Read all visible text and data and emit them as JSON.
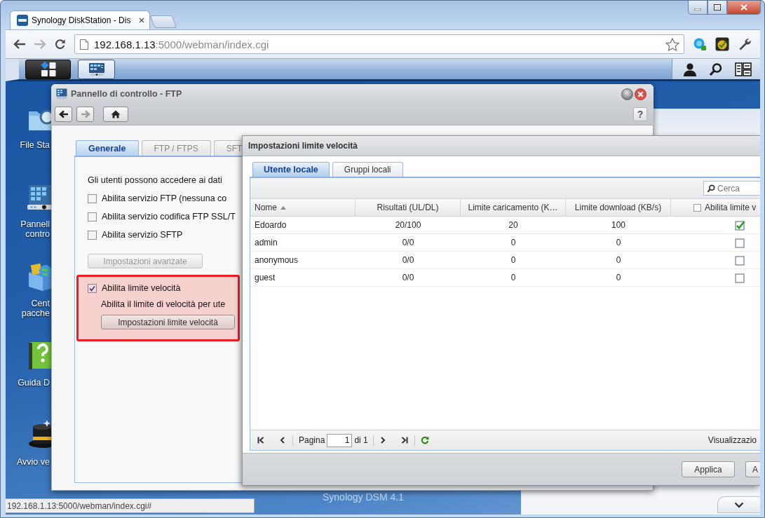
{
  "browser": {
    "tabs": [
      {
        "title": "Synology DiskStation - Dis",
        "selected": true
      }
    ],
    "nav": {
      "back_disabled": false,
      "forward_disabled": true
    },
    "address": {
      "host": "192.168.1.13",
      "path": ":5000/webman/index.cgi"
    },
    "status_url": "192.168.1.13:5000/webman/index.cgi#"
  },
  "desktop": {
    "icons": [
      {
        "label": [
          "File Sta"
        ]
      },
      {
        "label": [
          "Pannell",
          "contro"
        ]
      },
      {
        "label": [
          "Cent",
          "pacche"
        ]
      },
      {
        "label": [
          "Guida D"
        ]
      },
      {
        "label": [
          "Avvio ve"
        ]
      }
    ],
    "logo": "Synology DSM 4.1"
  },
  "control_panel": {
    "title": "Pannello di controllo - FTP",
    "nav": {
      "back_disabled": false,
      "forward_disabled": true
    },
    "help": "?",
    "tabs": [
      {
        "label": "Generale",
        "selected": true
      },
      {
        "label": "FTP / FTPS",
        "selected": false
      },
      {
        "label": "SFT",
        "selected": false
      }
    ],
    "intro": "Gli utenti possono accedere ai dati",
    "options": [
      {
        "label": "Abilita servizio FTP (nessuna co",
        "checked": false
      },
      {
        "label": "Abilita servizio codifica FTP SSL/T",
        "checked": false
      },
      {
        "label": "Abilita servizio SFTP",
        "checked": false
      }
    ],
    "advanced_button": {
      "label": "Impostazioni avanzate",
      "disabled": true
    },
    "speed_limit": {
      "label": "Abilita limite velocità",
      "checked": true,
      "description": "Abilita il limite di velocità per ute",
      "button": "Impostazioni limite velocità"
    }
  },
  "dialog": {
    "title": "Impostazioni limite velocità",
    "tabs": [
      {
        "label": "Utente locale",
        "selected": true
      },
      {
        "label": "Gruppi locali",
        "selected": false
      }
    ],
    "search": {
      "placeholder": "Cerca"
    },
    "columns": [
      {
        "kind": "text",
        "label": "Nome",
        "sorted_ascending": true
      },
      {
        "kind": "text",
        "label": "Risultati (UL/DL)"
      },
      {
        "kind": "text",
        "label": "Limite caricamento (K…"
      },
      {
        "kind": "text",
        "label": "Limite download (KB/s)"
      },
      {
        "kind": "check",
        "label": "Abilita limite v",
        "checked": false
      }
    ],
    "rows": [
      {
        "cells": [
          "Edoardo",
          "20/100",
          "20",
          "100"
        ],
        "limit_enabled": true
      },
      {
        "cells": [
          "admin",
          "0/0",
          "0",
          "0"
        ],
        "limit_enabled": false
      },
      {
        "cells": [
          "anonymous",
          "0/0",
          "0",
          "0"
        ],
        "limit_enabled": false
      },
      {
        "cells": [
          "guest",
          "0/0",
          "0",
          "0"
        ],
        "limit_enabled": false
      }
    ],
    "pager": {
      "page_label": "Pagina",
      "page": "1",
      "page_count": "di 1",
      "display": "Visualizzazio"
    },
    "buttons": [
      "Applica",
      "A"
    ]
  }
}
